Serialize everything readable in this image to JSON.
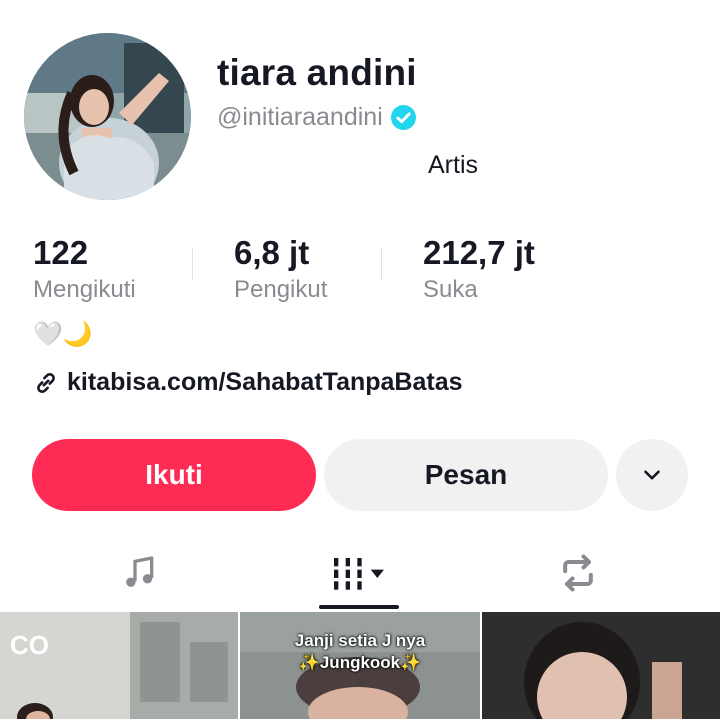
{
  "profile": {
    "name": "tiara andini",
    "handle": "@initiaraandini",
    "category": "Artis",
    "bio_emoji": "🤍🌙",
    "link": "kitabisa.com/SahabatTanpaBatas"
  },
  "stats": [
    {
      "value": "122",
      "label": "Mengikuti"
    },
    {
      "value": "6,8 jt",
      "label": "Pengikut"
    },
    {
      "value": "212,7 jt",
      "label": "Suka"
    }
  ],
  "actions": {
    "follow_label": "Ikuti",
    "message_label": "Pesan"
  },
  "tabs": [
    {
      "icon": "music-note-icon"
    },
    {
      "icon": "grid-icon",
      "active": true
    },
    {
      "icon": "repost-icon"
    }
  ],
  "thumbnails": [
    {
      "caption": "",
      "badge": "CO"
    },
    {
      "caption_line1": "Janji setia J nya",
      "caption_line2": "✨Jungkook✨"
    },
    {
      "caption": ""
    }
  ],
  "colors": {
    "accent": "#fe2c55",
    "verified": "#20d5ec",
    "secondary_text": "#8a8b91",
    "button_grey": "#f1f1f2"
  }
}
